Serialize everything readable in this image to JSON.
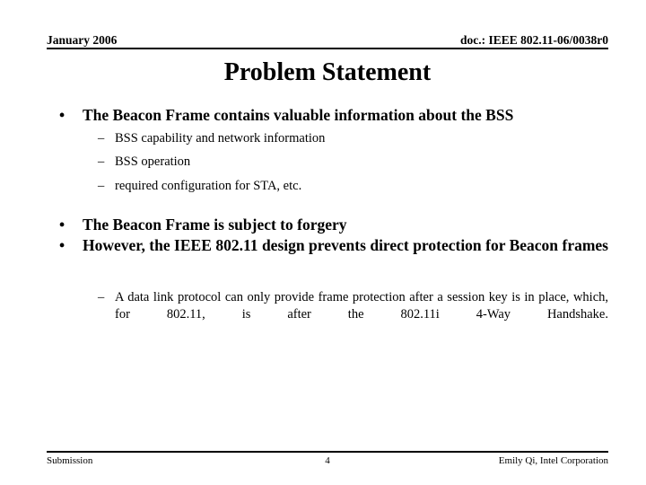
{
  "header": {
    "left": "January 2006",
    "right": "doc.: IEEE 802.11-06/0038r0"
  },
  "title": "Problem Statement",
  "body": {
    "bullet_marker": "•",
    "sub_marker": "–",
    "items": [
      {
        "level": 1,
        "text": "The Beacon Frame contains valuable information about the BSS"
      },
      {
        "level": 2,
        "text": "BSS capability and network information"
      },
      {
        "level": 2,
        "text": "BSS operation"
      },
      {
        "level": 2,
        "text": "required configuration for STA, etc."
      },
      {
        "level": 1,
        "text": "The Beacon Frame is subject to forgery"
      },
      {
        "level": 1,
        "text": "However, the IEEE 802.11 design prevents direct protection for Beacon frames"
      },
      {
        "level": 2,
        "text": "A data link protocol can only provide frame protection after a session key is in place, which, for 802.11, is after the 802.11i 4-Way Handshake."
      }
    ]
  },
  "footer": {
    "left": "Submission",
    "page": "4",
    "right": "Emily Qi, Intel Corporation"
  }
}
